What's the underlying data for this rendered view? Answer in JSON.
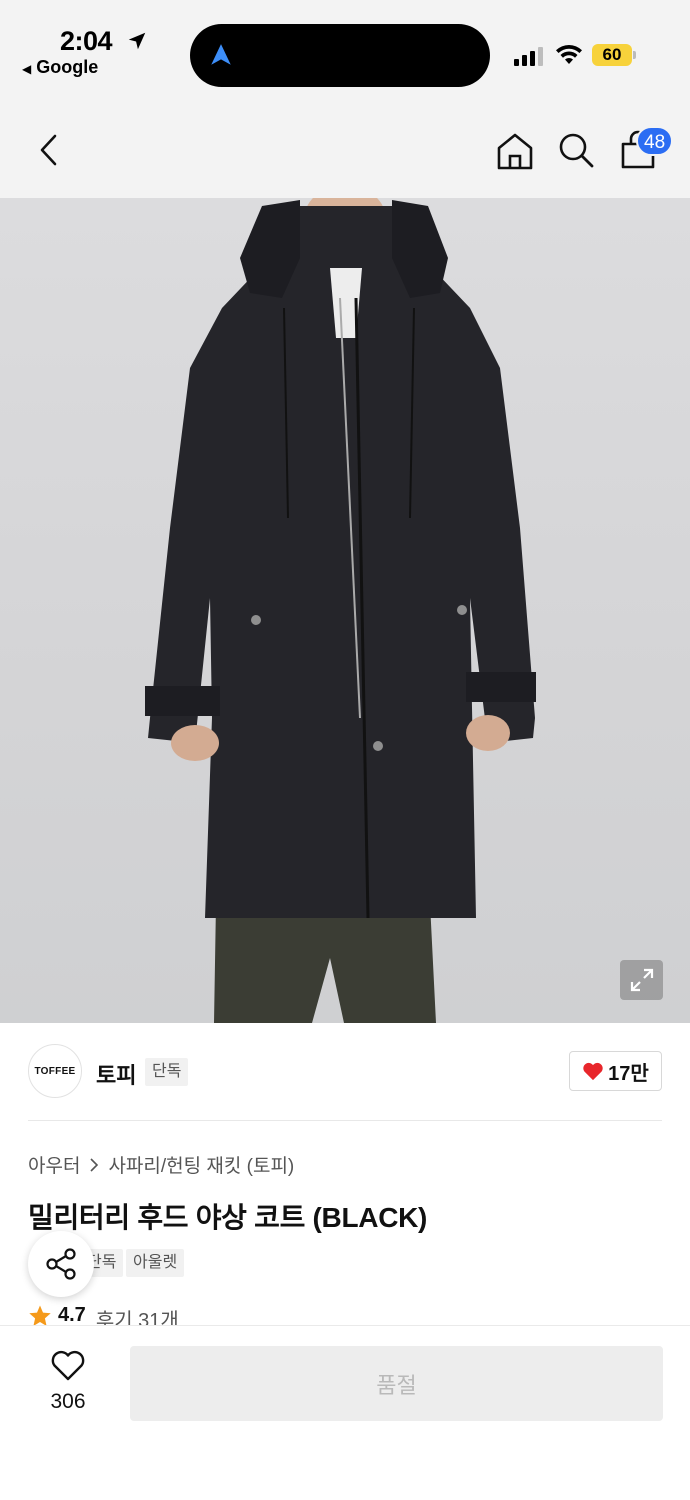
{
  "status_bar": {
    "time": "2:04",
    "back_app": "Google",
    "battery": "60",
    "battery_color": "#f7d23b"
  },
  "header": {
    "cart_count": "48",
    "badge_color": "#2b6df3"
  },
  "product": {
    "image_alt": "",
    "brand": {
      "logo_text": "TOFFEE",
      "name": "토피",
      "tag": "단독"
    },
    "likes": "17만",
    "breadcrumb": {
      "level1": "아우터",
      "level2": "사파리/헌팅 재킷 (토피)"
    },
    "title": "밀리터리 후드 야상 코트 (BLACK)",
    "tags": [
      "단독",
      "아울렛"
    ],
    "rating": "4.7",
    "reviews": "후기 31개"
  },
  "bottom_bar": {
    "wish_count": "306",
    "buy_label": "품절"
  },
  "icons": {
    "back": "chevron-left-icon",
    "home": "home-icon",
    "search": "search-icon",
    "cart": "shopping-bag-icon",
    "expand": "expand-icon",
    "share": "share-icon",
    "star": "star-icon",
    "wish": "heart-outline-icon",
    "like": "heart-filled-icon"
  }
}
